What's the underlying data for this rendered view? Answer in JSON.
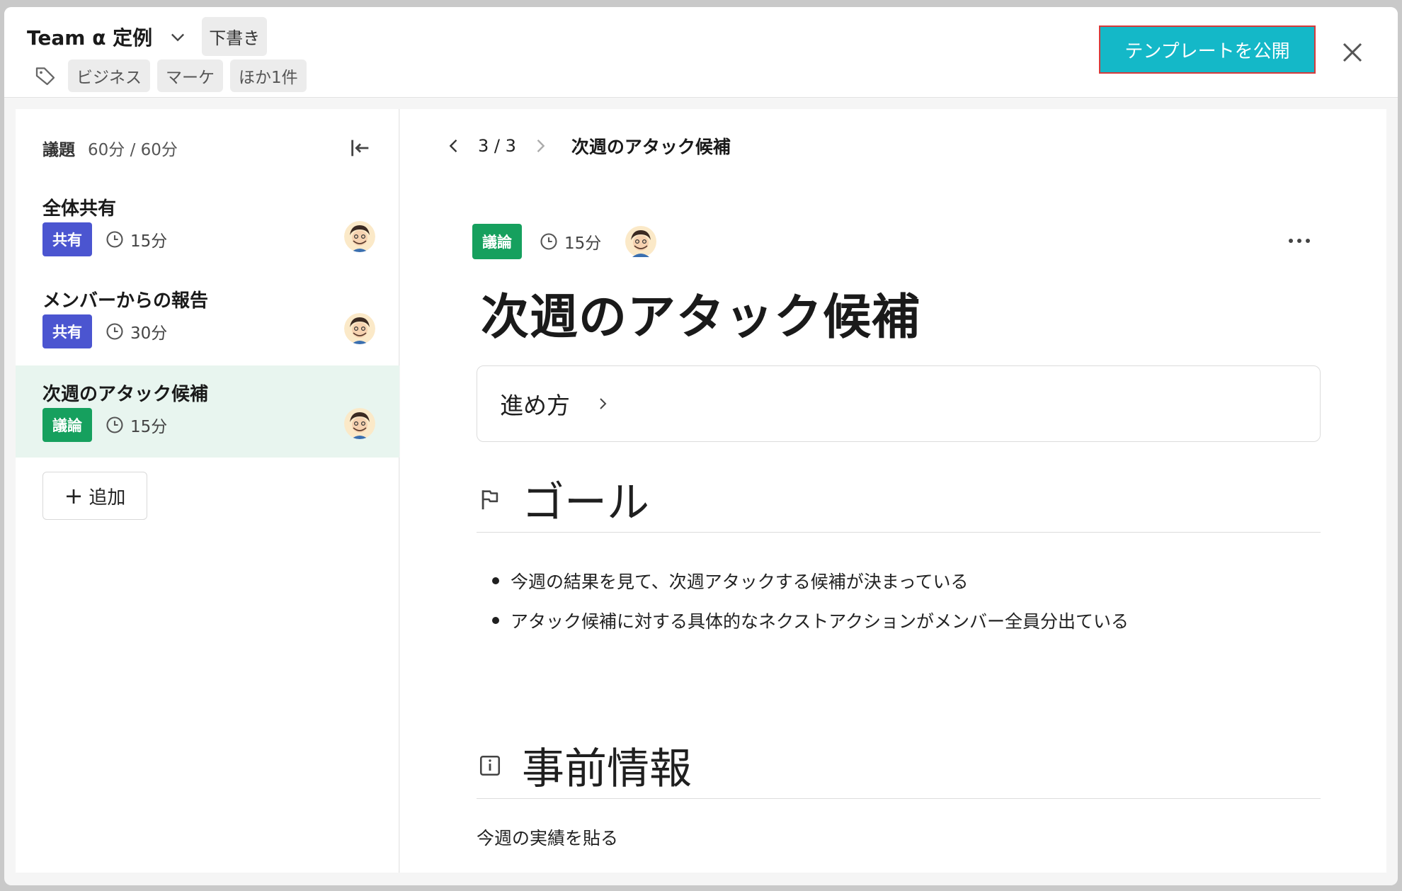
{
  "header": {
    "title": "Team α 定例",
    "status": "下書き",
    "tags": [
      "ビジネス",
      "マーケ",
      "ほか1件"
    ],
    "publish_label": "テンプレートを公開"
  },
  "sidebar": {
    "label": "議題",
    "duration": "60分 / 60分",
    "items": [
      {
        "title": "全体共有",
        "badge": "共有",
        "time": "15分"
      },
      {
        "title": "メンバーからの報告",
        "badge": "共有",
        "time": "30分"
      },
      {
        "title": "次週のアタック候補",
        "badge": "議論",
        "time": "15分"
      }
    ],
    "add_label": "追加"
  },
  "main": {
    "pager": "3 / 3",
    "pager_title": "次週のアタック候補",
    "badge": "議論",
    "time": "15分",
    "heading": "次週のアタック候補",
    "method_label": "進め方",
    "goal_title": "ゴール",
    "goals": [
      "今週の結果を見て、次週アタックする候補が決まっている",
      "アタック候補に対する具体的なネクストアクションがメンバー全員分出ている"
    ],
    "info_title": "事前情報",
    "info_text": "今週の実績を貼る"
  },
  "colors": {
    "accent": "#14b8c8",
    "share_badge": "#4b55d0",
    "discuss_badge": "#16a05e",
    "active_row": "#e8f5ef"
  },
  "icons": [
    "chevron-down-icon",
    "tag-icon",
    "close-icon",
    "collapse-left-icon",
    "clock-icon",
    "chevron-left-icon",
    "chevron-right-icon",
    "more-icon",
    "flag-icon",
    "info-icon",
    "plus-icon"
  ]
}
